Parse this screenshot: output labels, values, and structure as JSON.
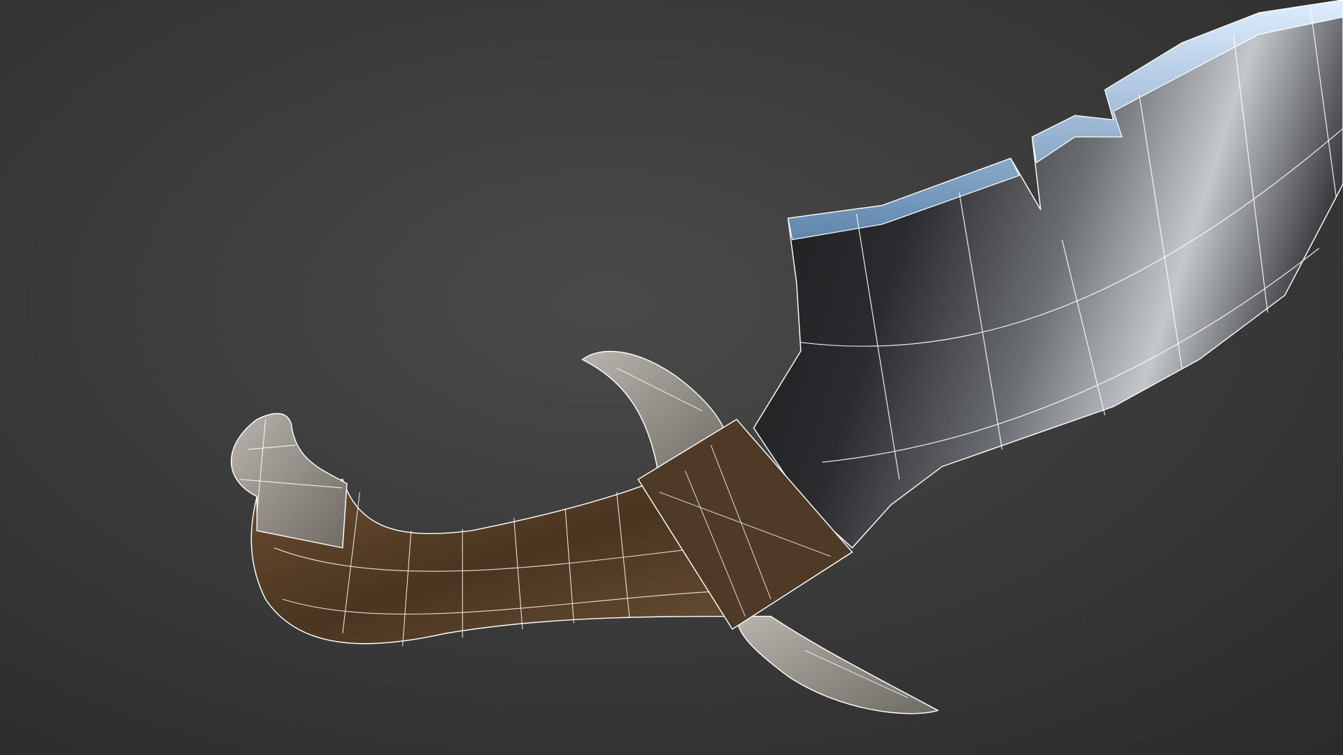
{
  "scene": {
    "subject": "curved-dagger-wireframe-render",
    "colors": {
      "background_center": "#4a4a4a",
      "background_edge": "#2e2e2e",
      "blade_dark": "#1c1c1e",
      "blade_light": "#bfc2c6",
      "edge_blue": "#9ec3e6",
      "wood": "#5a4128",
      "bone": "#9a968f",
      "wire": "#ffffff"
    }
  }
}
